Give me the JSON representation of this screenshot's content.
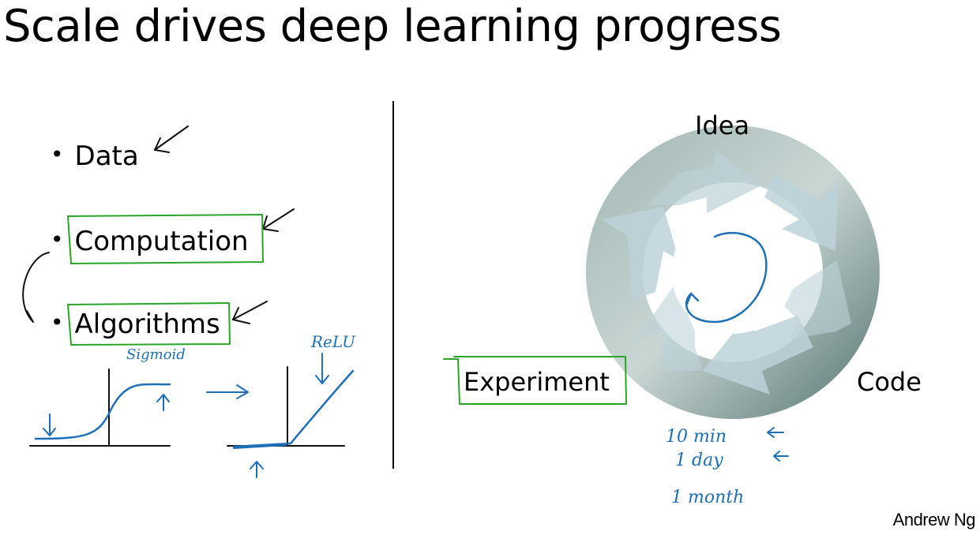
{
  "slide": {
    "title": "Scale drives deep learning progress",
    "bullets": [
      {
        "text": "Data"
      },
      {
        "text": "Computation"
      },
      {
        "text": "Algorithms"
      }
    ],
    "cycle": {
      "labels": {
        "idea": "Idea",
        "code": "Code",
        "experiment": "Experiment"
      }
    },
    "annotations": {
      "sigmoid": "Sigmoid",
      "relu": "ReLU",
      "times": [
        "10 min",
        "1 day",
        "1 month"
      ]
    },
    "author": "Andrew Ng",
    "bullet_glyph": "•"
  },
  "colors": {
    "pen_green": "#2aa52a",
    "pen_blue": "#1f6fb8",
    "ring_dark": "#6e8a86",
    "ring_light": "#d9e3e2",
    "arrow_fill": "#b9cfd6"
  }
}
